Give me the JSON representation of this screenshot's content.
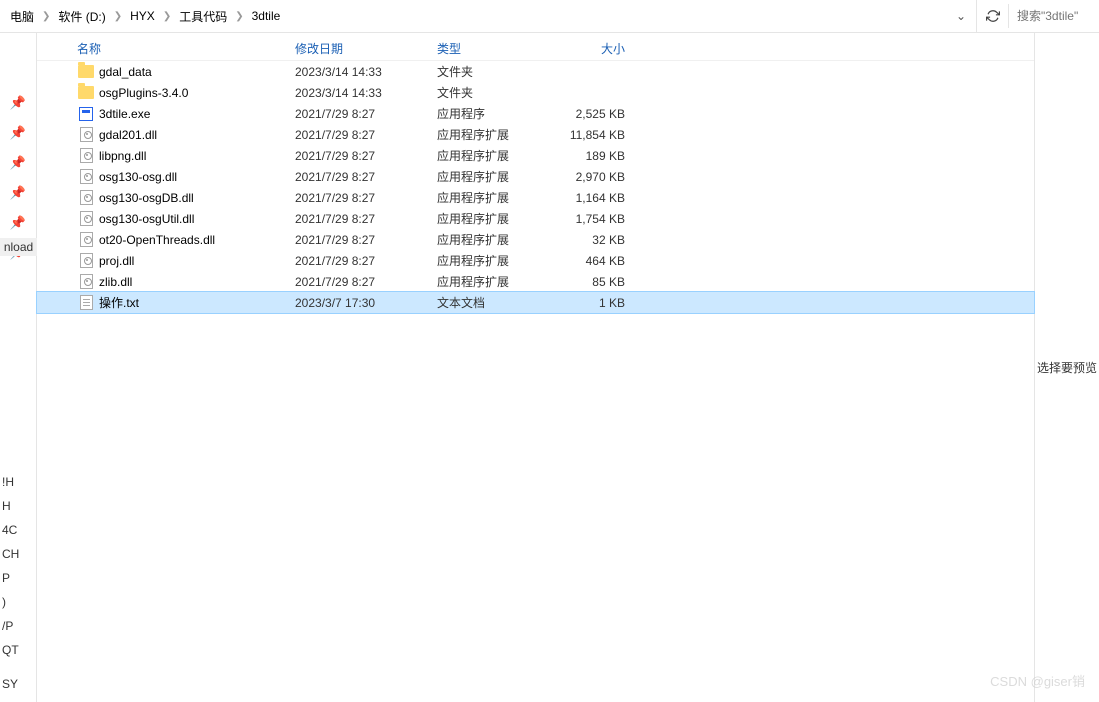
{
  "breadcrumbs": [
    "电脑",
    "软件 (D:)",
    "HYX",
    "工具代码",
    "3dtile"
  ],
  "search": {
    "placeholder": "搜索\"3dtile\""
  },
  "columns": {
    "name": "名称",
    "date": "修改日期",
    "type": "类型",
    "size": "大小"
  },
  "left_partial": "nload",
  "left_bottom": [
    "!H",
    "H",
    "4C",
    "CH",
    "P",
    ")",
    "/P",
    "QT",
    "",
    "SY"
  ],
  "files": [
    {
      "icon": "folder",
      "name": "gdal_data",
      "date": "2023/3/14 14:33",
      "type": "文件夹",
      "size": ""
    },
    {
      "icon": "folder",
      "name": "osgPlugins-3.4.0",
      "date": "2023/3/14 14:33",
      "type": "文件夹",
      "size": ""
    },
    {
      "icon": "exe",
      "name": "3dtile.exe",
      "date": "2021/7/29 8:27",
      "type": "应用程序",
      "size": "2,525 KB"
    },
    {
      "icon": "dll",
      "name": "gdal201.dll",
      "date": "2021/7/29 8:27",
      "type": "应用程序扩展",
      "size": "11,854 KB"
    },
    {
      "icon": "dll",
      "name": "libpng.dll",
      "date": "2021/7/29 8:27",
      "type": "应用程序扩展",
      "size": "189 KB"
    },
    {
      "icon": "dll",
      "name": "osg130-osg.dll",
      "date": "2021/7/29 8:27",
      "type": "应用程序扩展",
      "size": "2,970 KB"
    },
    {
      "icon": "dll",
      "name": "osg130-osgDB.dll",
      "date": "2021/7/29 8:27",
      "type": "应用程序扩展",
      "size": "1,164 KB"
    },
    {
      "icon": "dll",
      "name": "osg130-osgUtil.dll",
      "date": "2021/7/29 8:27",
      "type": "应用程序扩展",
      "size": "1,754 KB"
    },
    {
      "icon": "dll",
      "name": "ot20-OpenThreads.dll",
      "date": "2021/7/29 8:27",
      "type": "应用程序扩展",
      "size": "32 KB"
    },
    {
      "icon": "dll",
      "name": "proj.dll",
      "date": "2021/7/29 8:27",
      "type": "应用程序扩展",
      "size": "464 KB"
    },
    {
      "icon": "dll",
      "name": "zlib.dll",
      "date": "2021/7/29 8:27",
      "type": "应用程序扩展",
      "size": "85 KB"
    },
    {
      "icon": "txt",
      "name": "操作.txt",
      "date": "2023/3/7 17:30",
      "type": "文本文档",
      "size": "1 KB",
      "selected": true
    }
  ],
  "preview_text": "选择要预览",
  "watermark": "CSDN @giser销"
}
